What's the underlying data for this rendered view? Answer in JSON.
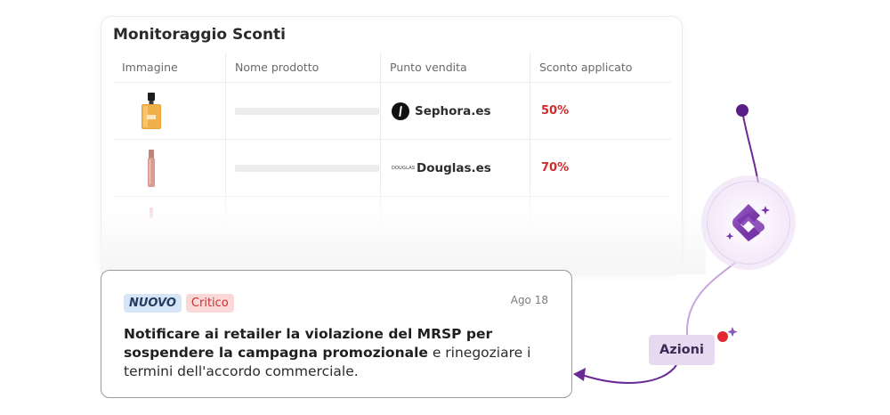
{
  "card": {
    "title": "Monitoraggio Sconti",
    "columns": [
      "Immagine",
      "Nome prodotto",
      "Punto vendita",
      "Sconto applicato"
    ],
    "rows": [
      {
        "image_icon": "perfume-bottle-icon",
        "store": "Sephora.es",
        "store_logo": "sephora-logo",
        "discount": "50%"
      },
      {
        "image_icon": "lipgloss-icon",
        "store": "Douglas.es",
        "store_logo": "douglas-logo",
        "store_logo_text": "DOUGLAS",
        "discount": "70%"
      }
    ]
  },
  "notification": {
    "badge_new": "NUOVO",
    "badge_critical": "Critico",
    "date": "Ago 18",
    "text_bold": "Notificare ai retailer la violazione del MRSP per sospendere la campagna promozionale",
    "text_rest": " e rinegoziare i termini dell'accordo commerciale."
  },
  "flow": {
    "action_label": "Azioni",
    "hub_icon": "ai-copilot-icon",
    "colors": {
      "purple": "#6b2a96",
      "line": "#c7a6dd",
      "red": "#e3262f"
    }
  },
  "colors": {
    "discount_red": "#d32b2b",
    "badge_new_bg": "#d6e6f7",
    "badge_crit_bg": "#fbd8d8"
  }
}
